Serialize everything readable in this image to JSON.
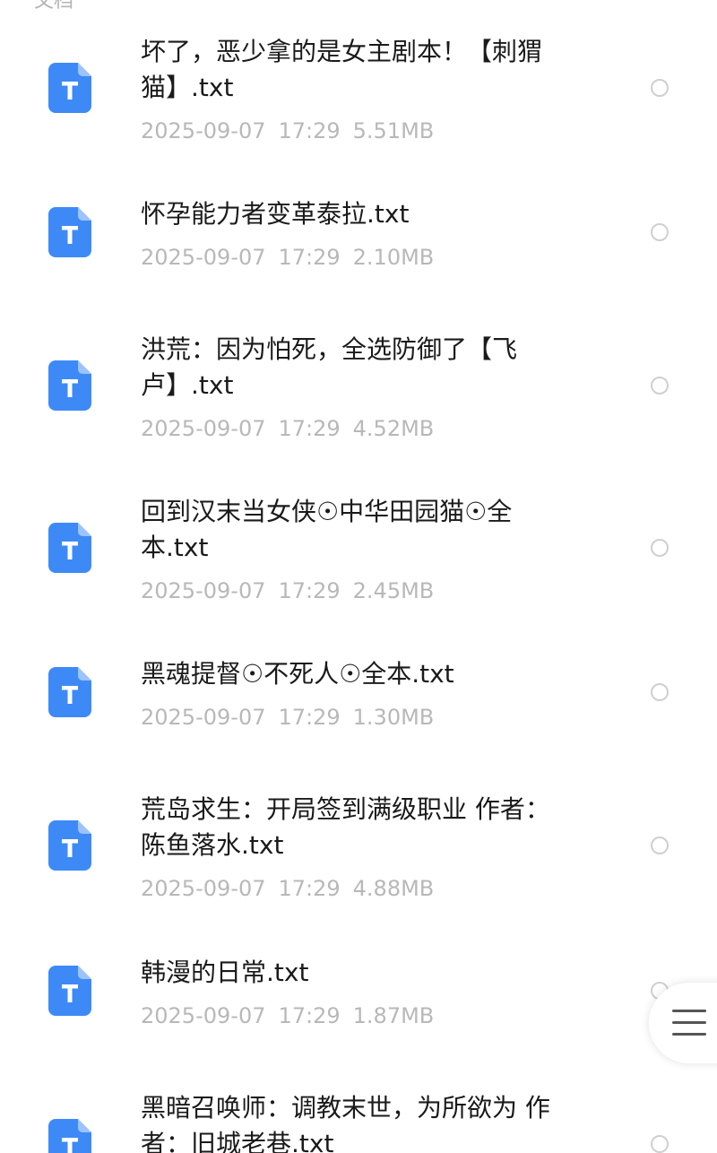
{
  "section": {
    "label": "文档"
  },
  "colors": {
    "icon_blue": "#3d8af7",
    "icon_fold": "#9cc4fb",
    "meta_gray": "#b8b8b8"
  },
  "files": [
    {
      "title": "坏了，恶少拿的是女主剧本！【刺猬\n猫】.txt",
      "date": "2025-09-07",
      "time": "17:29",
      "size": "5.51MB",
      "icon": "txt-file-icon"
    },
    {
      "title": "怀孕能力者变革泰拉.txt",
      "date": "2025-09-07",
      "time": "17:29",
      "size": "2.10MB",
      "icon": "txt-file-icon"
    },
    {
      "title": "洪荒：因为怕死，全选防御了【飞\n卢】.txt",
      "date": "2025-09-07",
      "time": "17:29",
      "size": "4.52MB",
      "icon": "txt-file-icon"
    },
    {
      "title": "回到汉末当女侠☉中华田园猫☉全\n本.txt",
      "date": "2025-09-07",
      "time": "17:29",
      "size": "2.45MB",
      "icon": "txt-file-icon"
    },
    {
      "title": "黑魂提督☉不死人☉全本.txt",
      "date": "2025-09-07",
      "time": "17:29",
      "size": "1.30MB",
      "icon": "txt-file-icon"
    },
    {
      "title": "荒岛求生：开局签到满级职业  作者：\n陈鱼落水.txt",
      "date": "2025-09-07",
      "time": "17:29",
      "size": "4.88MB",
      "icon": "txt-file-icon"
    },
    {
      "title": "韩漫的日常.txt",
      "date": "2025-09-07",
      "time": "17:29",
      "size": "1.87MB",
      "icon": "txt-file-icon"
    },
    {
      "title": "黑暗召唤师：调教末世，为所欲为 作\n者：旧城老巷.txt",
      "date": "",
      "time": "",
      "size": "",
      "icon": "txt-file-icon"
    }
  ],
  "fab": {
    "icon": "menu-icon"
  }
}
